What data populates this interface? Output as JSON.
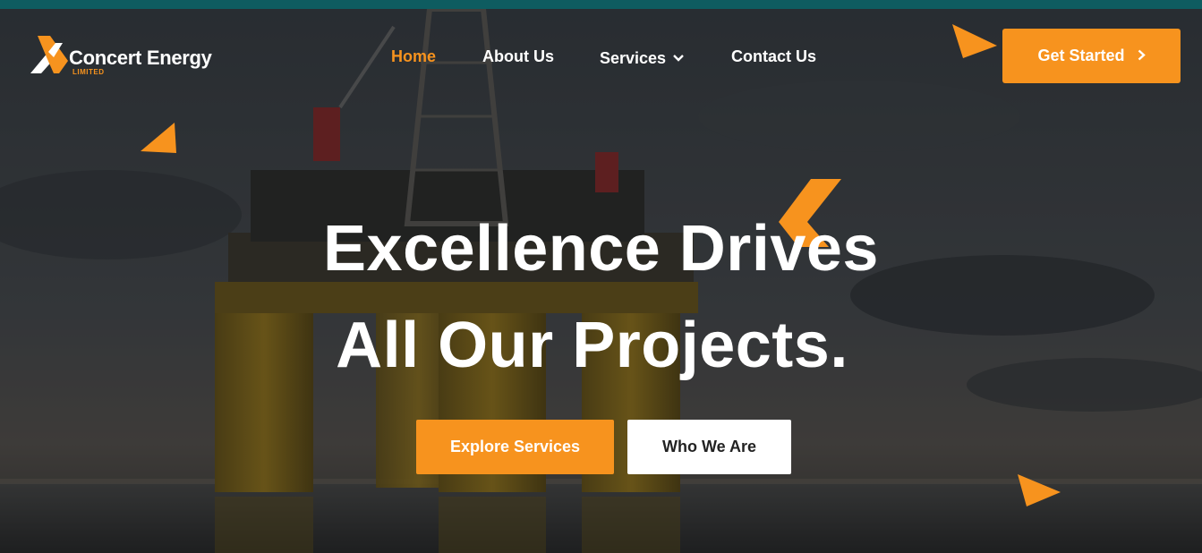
{
  "brand": {
    "name": "Concert Energy",
    "tagline": "LIMITED"
  },
  "nav": {
    "items": [
      {
        "label": "Home",
        "active": true
      },
      {
        "label": "About Us",
        "active": false
      },
      {
        "label": "Services",
        "active": false,
        "dropdown": true
      },
      {
        "label": "Contact Us",
        "active": false
      }
    ]
  },
  "header": {
    "cta_label": "Get Started"
  },
  "hero": {
    "line1": "Excellence Drives",
    "line2": "All Our Projects.",
    "primary_button": "Explore Services",
    "secondary_button": "Who We Are"
  },
  "colors": {
    "accent": "#f7931e",
    "topbar": "#0e5c60",
    "text": "#ffffff"
  },
  "icons": [
    "logo-mark-icon",
    "chevron-down-icon",
    "chevron-right-icon",
    "triangle-decor-icon"
  ]
}
